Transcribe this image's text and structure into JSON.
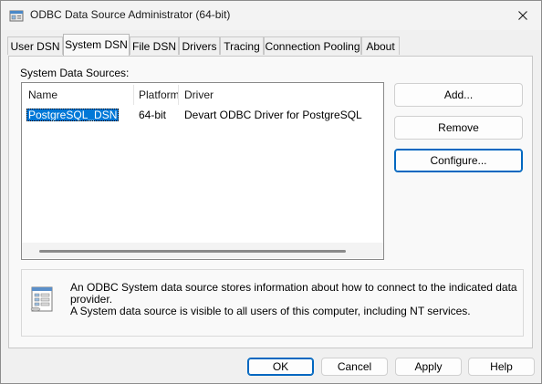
{
  "window": {
    "title": "ODBC Data Source Administrator (64-bit)"
  },
  "tabs": [
    {
      "label": "User DSN"
    },
    {
      "label": "System DSN",
      "active": true
    },
    {
      "label": "File DSN"
    },
    {
      "label": "Drivers"
    },
    {
      "label": "Tracing"
    },
    {
      "label": "Connection Pooling"
    },
    {
      "label": "About"
    }
  ],
  "system_dsn": {
    "section_label": "System Data Sources:",
    "columns": [
      "Name",
      "Platform",
      "Driver"
    ],
    "rows": [
      {
        "name": "PostgreSQL_DSN",
        "platform": "64-bit",
        "driver": "Devart ODBC Driver for PostgreSQL",
        "selected": true
      }
    ],
    "buttons": {
      "add": "Add...",
      "remove": "Remove",
      "configure": "Configure..."
    },
    "info_text": [
      "An ODBC System data source stores information about how to connect to the indicated data provider.",
      "A System data source is visible to all users of this computer, including NT services."
    ]
  },
  "footer": {
    "ok": "OK",
    "cancel": "Cancel",
    "apply": "Apply",
    "help": "Help"
  },
  "icons": {
    "app": "odbc-admin-icon",
    "close": "close-icon",
    "info": "database-info-icon"
  },
  "colors": {
    "selection": "#0078d7",
    "focus_border": "#0067c0"
  }
}
